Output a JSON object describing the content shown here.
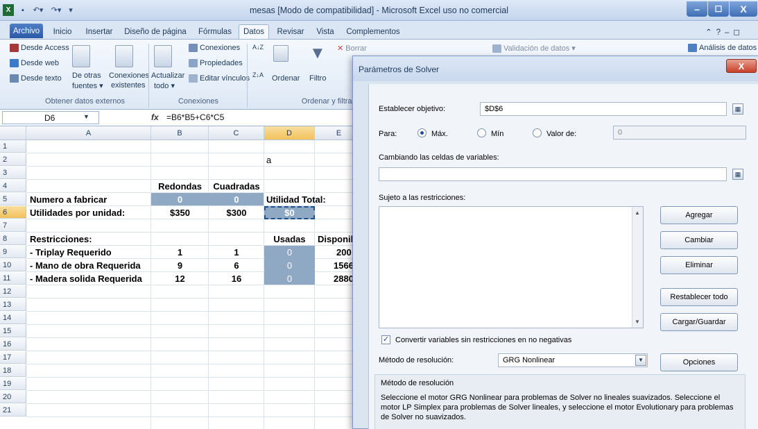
{
  "window": {
    "title": "mesas  [Modo de compatibilidad]  -  Microsoft Excel uso no comercial",
    "min": "–",
    "max": "☐",
    "close": "X"
  },
  "ribbon_tabs": [
    "Archivo",
    "Inicio",
    "Insertar",
    "Diseño de página",
    "Fórmulas",
    "Datos",
    "Revisar",
    "Vista",
    "Complementos"
  ],
  "ribbon": {
    "ext": {
      "access": "Desde Access",
      "web": "Desde web",
      "texto": "Desde texto",
      "otras": "De otras",
      "fuentes": "fuentes ▾",
      "conexiones": "Conexiones",
      "existentes": "existentes",
      "caption": "Obtener datos externos"
    },
    "conn": {
      "actualizar": "Actualizar",
      "todo": "todo ▾",
      "conexiones": "Conexiones",
      "propiedades": "Propiedades",
      "editar": "Editar vínculos",
      "caption": "Conexiones"
    },
    "sort": {
      "ordenar": "Ordenar",
      "filtro": "Filtro",
      "borrar": "Borrar",
      "caption": "Ordenar y filtrar"
    },
    "tools": {
      "validacion": "Validación de datos ▾",
      "analisis": "Análisis de datos"
    }
  },
  "formula_bar": {
    "name": "D6",
    "fx": "fx",
    "formula": "=B6*B5+C6*C5"
  },
  "sheet": {
    "columns": [
      "A",
      "B",
      "C",
      "D",
      "E"
    ],
    "rows": [
      "1",
      "2",
      "3",
      "4",
      "5",
      "6",
      "7",
      "8",
      "9",
      "10",
      "11",
      "12",
      "13",
      "14",
      "15",
      "16",
      "17",
      "18",
      "19",
      "20",
      "21"
    ],
    "d2": "a",
    "b4": "Redondas",
    "c4": "Cuadradas",
    "a5": "Numero a fabricar",
    "b5": "0",
    "c5": "0",
    "d5": "Utilidad Total:",
    "a6": "Utilidades por unidad:",
    "b6": "$350",
    "c6": "$300",
    "d6": "$0",
    "a8": "Restricciones:",
    "d8": "Usadas",
    "e8": "Disponib",
    "a9": " - Triplay Requerido",
    "b9": "1",
    "c9": "1",
    "d9": "0",
    "e9": "200",
    "a10": " - Mano de obra Requerida",
    "b10": "9",
    "c10": "6",
    "d10": "0",
    "e10": "1566",
    "a11": " - Madera solida Requerida",
    "b11": "12",
    "c11": "16",
    "d11": "0",
    "e11": "2880"
  },
  "solver": {
    "title": "Parámetros de Solver",
    "close": "X",
    "objective_label": "Establecer objetivo:",
    "objective_value": "$D$6",
    "para_label": "Para:",
    "max": "Máx.",
    "min": "Mín",
    "valor": "Valor de:",
    "valor_value": "0",
    "vars_label": "Cambiando las celdas de variables:",
    "vars_value": "",
    "constraints_label": "Sujeto a las restricciones:",
    "btn_agregar": "Agregar",
    "btn_cambiar": "Cambiar",
    "btn_eliminar": "Eliminar",
    "btn_restablecer": "Restablecer todo",
    "btn_cargar": "Cargar/Guardar",
    "nonneg_label": "Convertir variables sin restricciones en no negativas",
    "method_label": "Método de resolución:",
    "method_value": "GRG Nonlinear",
    "btn_opciones": "Opciones",
    "desc_title": "Método de resolución",
    "desc_text": "Seleccione el motor GRG Nonlinear para problemas de Solver no lineales suavizados. Seleccione el motor LP Simplex para problemas de Solver lineales, y seleccione el motor Evolutionary para problemas de Solver no suavizados."
  }
}
